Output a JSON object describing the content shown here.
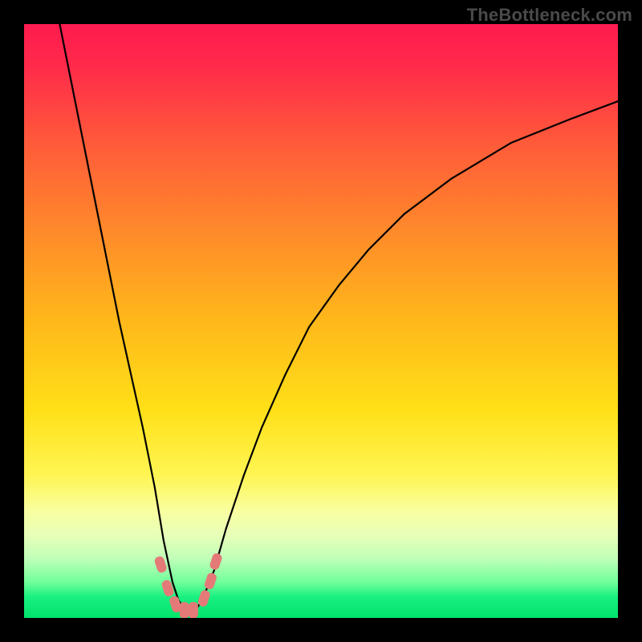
{
  "watermark": "TheBottleneck.com",
  "colors": {
    "black": "#000000",
    "marker": "#e47a78",
    "gradient_stops": [
      {
        "offset": 0.0,
        "color": "#ff1a4f"
      },
      {
        "offset": 0.07,
        "color": "#ff2a4a"
      },
      {
        "offset": 0.2,
        "color": "#ff5a3a"
      },
      {
        "offset": 0.35,
        "color": "#ff8a2a"
      },
      {
        "offset": 0.5,
        "color": "#ffb81a"
      },
      {
        "offset": 0.65,
        "color": "#ffe018"
      },
      {
        "offset": 0.76,
        "color": "#fff553"
      },
      {
        "offset": 0.82,
        "color": "#f8ffa0"
      },
      {
        "offset": 0.86,
        "color": "#e8ffb8"
      },
      {
        "offset": 0.9,
        "color": "#c0ffb8"
      },
      {
        "offset": 0.94,
        "color": "#70ff9a"
      },
      {
        "offset": 0.965,
        "color": "#18f080"
      },
      {
        "offset": 1.0,
        "color": "#00e46a"
      }
    ]
  },
  "chart_data": {
    "type": "line",
    "title": "",
    "xlabel": "",
    "ylabel": "",
    "xlim": [
      0,
      100
    ],
    "ylim": [
      0,
      100
    ],
    "legend": false,
    "grid": false,
    "series": [
      {
        "name": "curve",
        "x": [
          6,
          8,
          10,
          12,
          14,
          16,
          18,
          20,
          22,
          23.5,
          25,
          26,
          27,
          28,
          29,
          30,
          32,
          34,
          37,
          40,
          44,
          48,
          53,
          58,
          64,
          72,
          82,
          92,
          100
        ],
        "y": [
          100,
          90,
          80,
          70,
          60,
          50,
          41,
          32,
          22,
          13,
          6,
          3,
          1.5,
          1,
          1.5,
          3,
          8,
          15,
          24,
          32,
          41,
          49,
          56,
          62,
          68,
          74,
          80,
          84,
          87
        ],
        "color": "#000000",
        "linewidth": 2.2
      }
    ],
    "markers": [
      {
        "x": 23.0,
        "y": 9.0
      },
      {
        "x": 24.2,
        "y": 5.0
      },
      {
        "x": 25.5,
        "y": 2.3
      },
      {
        "x": 27.0,
        "y": 1.3
      },
      {
        "x": 28.5,
        "y": 1.3
      },
      {
        "x": 30.3,
        "y": 3.3
      },
      {
        "x": 31.4,
        "y": 6.2
      },
      {
        "x": 32.3,
        "y": 9.5
      }
    ],
    "marker_size": 12
  }
}
